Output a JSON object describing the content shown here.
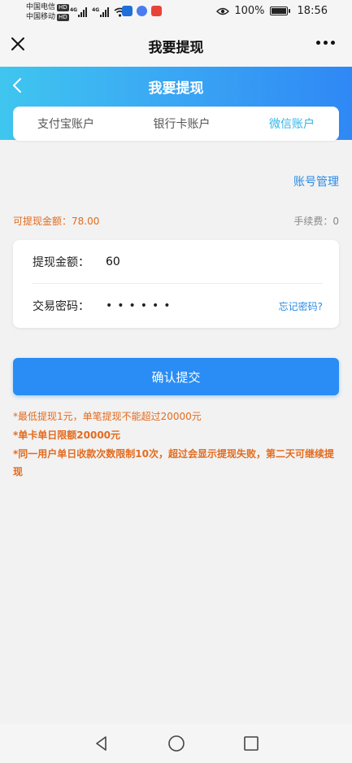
{
  "status_bar": {
    "carrier1": "中国电信",
    "carrier2": "中国移动",
    "hd_badge": "HD",
    "net1": "4G",
    "net2": "4G",
    "battery": "100%",
    "time": "18:56"
  },
  "top_nav": {
    "title": "我要提现"
  },
  "header": {
    "title": "我要提现"
  },
  "tabs": [
    {
      "label": "支付宝账户",
      "active": false
    },
    {
      "label": "银行卡账户",
      "active": false
    },
    {
      "label": "微信账户",
      "active": true
    }
  ],
  "account_manage": "账号管理",
  "balance_text": "可提现金额：78.00",
  "fee_text": "手续费：0",
  "form": {
    "amount_label": "提现金额：",
    "amount_value": "60",
    "password_label": "交易密码：",
    "password_value": "••••••",
    "forgot_link": "忘记密码?"
  },
  "submit_label": "确认提交",
  "notes": [
    "*最低提现1元，单笔提现不能超过20000元",
    "*单卡单日限额20000元",
    "*同一用户单日收款次数限制10次，超过会显示提现失败，第二天可继续提现"
  ],
  "colors": {
    "accent": "#2a8cf5",
    "active_tab": "#33b6e8",
    "warning": "#e46b1e"
  }
}
